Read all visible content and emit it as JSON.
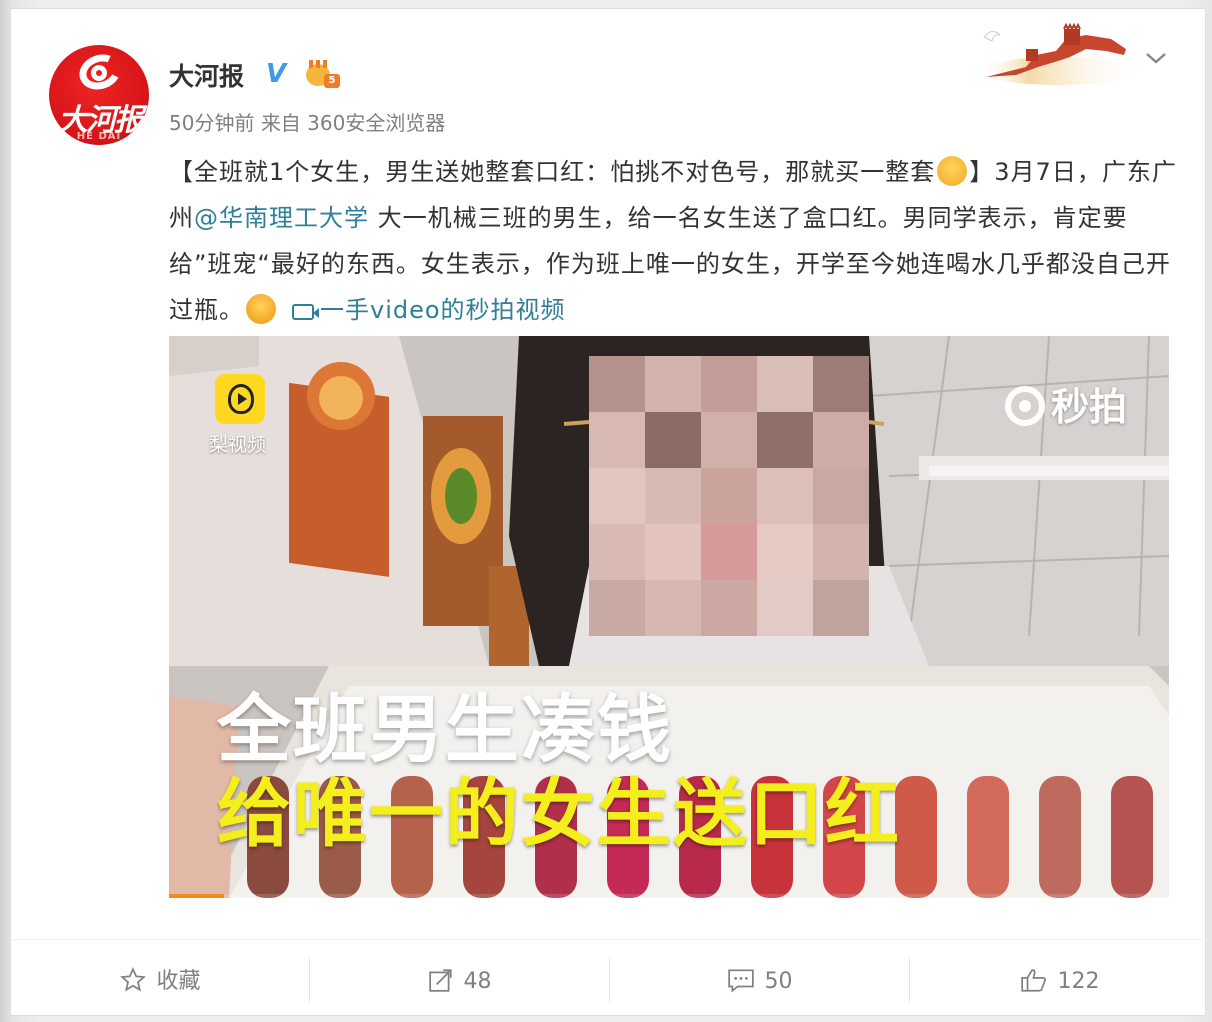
{
  "post": {
    "author": "大河报",
    "verified_badge": "V",
    "member_level": "5",
    "time": "50分钟前",
    "source": "来自 360安全浏览器",
    "avatar_text": "大河报",
    "avatar_subtext": "HE DAI",
    "text_part1": "【全班就1个女生，男生送她整套口红：怕挑不对色号，那就买一整套",
    "text_part2": "】3月7日，广东广州",
    "mention": "@华南理工大学",
    "text_part3": " 大一机械三班的男生，给一名女生送了盒口红。男同学表示，肯定要给”班宠“最好的东西。女生表示，作为班上唯一的女生，开学至今她连喝水几乎都没自己开过瓶。",
    "video_link": "一手video的秒拍视频"
  },
  "media": {
    "app_logo_label": "梨视频",
    "watermark": "秒拍",
    "caption_line1": "全班男生凑钱",
    "caption_line2": "给唯一的女生送口红",
    "progress_fraction": 0.055
  },
  "actions": {
    "favorite_label": "收藏",
    "repost_count": "48",
    "comment_count": "50",
    "like_count": "122"
  },
  "icons": [
    "star-icon",
    "repost-icon",
    "comment-icon",
    "like-icon",
    "chevron-down-icon",
    "video-icon"
  ],
  "colors": {
    "link": "#2f7f98",
    "verified": "#3d9aea",
    "caption_yellow": "#f4ef1c",
    "progress": "#f28a1c"
  }
}
